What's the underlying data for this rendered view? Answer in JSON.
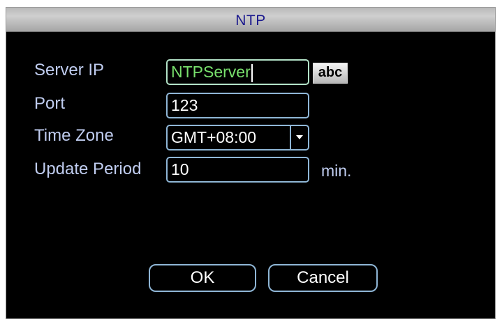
{
  "window": {
    "title": "NTP"
  },
  "form": {
    "server_ip": {
      "label": "Server IP",
      "value": "NTPServer"
    },
    "keyboard_button": {
      "label": "abc"
    },
    "port": {
      "label": "Port",
      "value": "123"
    },
    "time_zone": {
      "label": "Time Zone",
      "value": "GMT+08:00"
    },
    "update_period": {
      "label": "Update Period",
      "value": "10",
      "unit": "min."
    }
  },
  "actions": {
    "ok_label": "OK",
    "cancel_label": "Cancel"
  },
  "colors": {
    "background": "#000000",
    "label_text": "#c0cdf0",
    "field_border": "#8fb6d6",
    "active_text": "#78e06c",
    "title_text": "#1c1a8e"
  },
  "icons": {
    "dropdown": "chevron-down-icon",
    "pointer": "mouse-pointer-icon"
  }
}
